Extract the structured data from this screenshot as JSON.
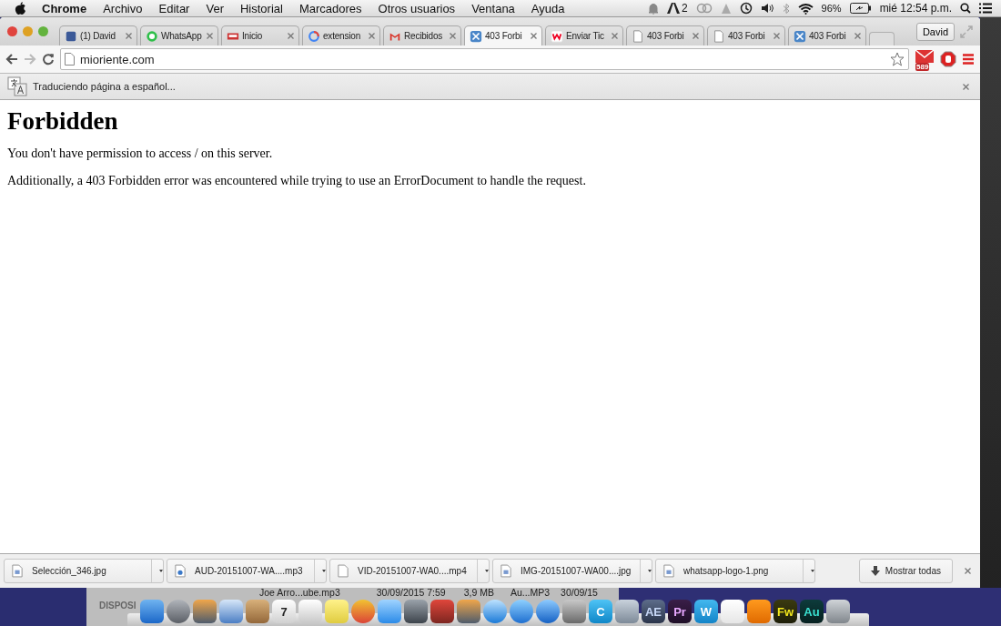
{
  "menu_bar": {
    "app": "Chrome",
    "items": [
      "Archivo",
      "Editar",
      "Ver",
      "Historial",
      "Marcadores",
      "Otros usuarios",
      "Ventana",
      "Ayuda"
    ],
    "status": {
      "adobe_count": "2",
      "battery": "96%",
      "clock": "mié 12:54 p.m."
    }
  },
  "browser": {
    "profile": "David",
    "tabs": [
      {
        "title": "(1) David",
        "kind": "blue-square",
        "selected": false
      },
      {
        "title": "WhatsApp",
        "kind": "green-circle",
        "selected": false
      },
      {
        "title": "Inicio",
        "kind": "banner",
        "selected": false
      },
      {
        "title": "extension",
        "kind": "ring",
        "selected": false
      },
      {
        "title": "Recibidos",
        "kind": "envelope",
        "selected": false
      },
      {
        "title": "403 Forbi",
        "kind": "tool",
        "selected": true
      },
      {
        "title": "Enviar Tic",
        "kind": "red-square",
        "selected": false
      },
      {
        "title": "403 Forbi",
        "kind": "page",
        "selected": false
      },
      {
        "title": "403 Forbi",
        "kind": "page",
        "selected": false
      },
      {
        "title": "403 Forbi",
        "kind": "tool",
        "selected": false
      }
    ],
    "url": "mioriente.com",
    "mail_badge": "589",
    "translate_bar": {
      "text": "Traduciendo página a español..."
    },
    "page": {
      "heading": "Forbidden",
      "paragraphs": [
        "You don't have permission to access / on this server.",
        "Additionally, a 403 Forbidden error was encountered while trying to use an ErrorDocument to handle the request."
      ]
    },
    "downloads": [
      {
        "name": "Selección_346.jpg",
        "kind": "image"
      },
      {
        "name": "AUD-20151007-WA....mp3",
        "kind": "audio"
      },
      {
        "name": "VID-20151007-WA0....mp4",
        "kind": "blank"
      },
      {
        "name": "IMG-20151007-WA00....jpg",
        "kind": "image"
      },
      {
        "name": "whatsapp-logo-1.png",
        "kind": "image"
      }
    ],
    "show_all": "Mostrar todas"
  },
  "background_window": {
    "sidebar_label": "DISPOSI",
    "row": [
      "Joe Arro...ube.mp3",
      "30/09/2015 7:59",
      "3,9 MB",
      "Au...MP3",
      "30/09/15"
    ]
  },
  "dock": [
    {
      "kind": "finder"
    },
    {
      "kind": "rocket"
    },
    {
      "kind": "photos"
    },
    {
      "kind": "stamp"
    },
    {
      "kind": "book"
    },
    {
      "kind": "calendar",
      "label": "7"
    },
    {
      "kind": "list"
    },
    {
      "kind": "note"
    },
    {
      "kind": "chrome"
    },
    {
      "kind": "bubble"
    },
    {
      "kind": "camera"
    },
    {
      "kind": "film"
    },
    {
      "kind": "photos"
    },
    {
      "kind": "compass"
    },
    {
      "kind": "music"
    },
    {
      "kind": "store"
    },
    {
      "kind": "gear"
    },
    {
      "kind": "letter",
      "label": "C"
    },
    {
      "kind": "disk"
    },
    {
      "kind": "adobe-ae",
      "label": "AE"
    },
    {
      "kind": "adobe-pr",
      "label": "Pr"
    },
    {
      "kind": "letter-w",
      "label": "W"
    },
    {
      "kind": "acrobat"
    },
    {
      "kind": "cone"
    },
    {
      "kind": "adobe-fw",
      "label": "Fw"
    },
    {
      "kind": "adobe-au",
      "label": "Au"
    },
    {
      "kind": "trash"
    }
  ]
}
